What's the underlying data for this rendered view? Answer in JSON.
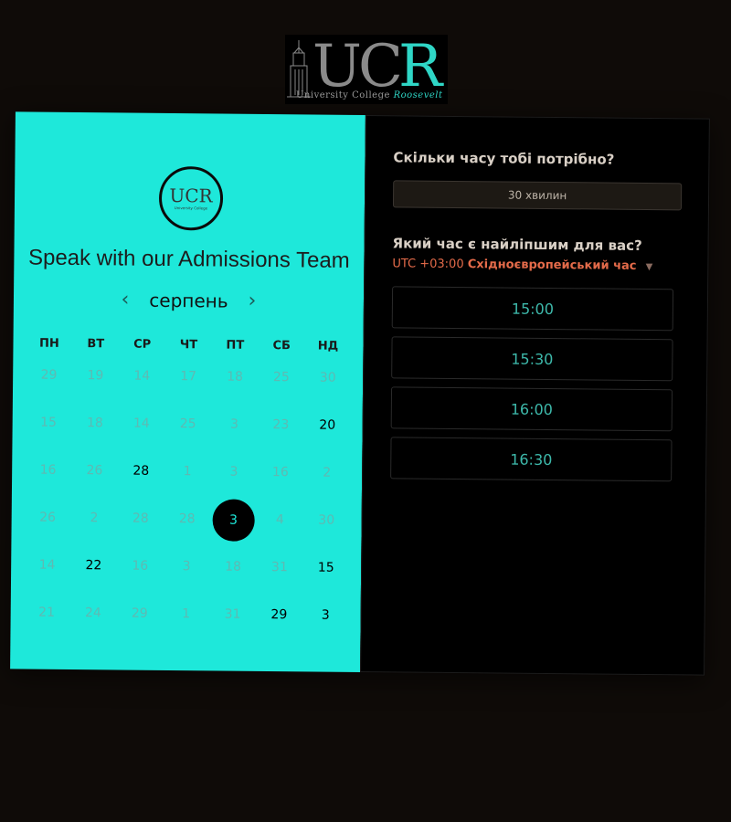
{
  "logo": {
    "letters_uc": "UC",
    "letter_r": "R",
    "subtitle_prefix": "University College",
    "subtitle_accent": "Roosevelt",
    "accent_color": "#2fd6c6"
  },
  "calendar": {
    "badge_text": "UCR",
    "title": "Speak with our Admissions Team",
    "month": "серпень",
    "prev_icon": "‹",
    "next_icon": "›",
    "weekdays": [
      "ПН",
      "ВТ",
      "СР",
      "ЧТ",
      "ПТ",
      "СБ",
      "НД"
    ],
    "weeks": [
      [
        {
          "d": "29"
        },
        {
          "d": "19"
        },
        {
          "d": "14"
        },
        {
          "d": "17"
        },
        {
          "d": "18"
        },
        {
          "d": "25"
        },
        {
          "d": "30"
        }
      ],
      [
        {
          "d": "15"
        },
        {
          "d": "18"
        },
        {
          "d": "14"
        },
        {
          "d": "25"
        },
        {
          "d": "3"
        },
        {
          "d": "23"
        },
        {
          "d": "20",
          "active": true
        }
      ],
      [
        {
          "d": "16"
        },
        {
          "d": "26"
        },
        {
          "d": "28",
          "active": true
        },
        {
          "d": "1"
        },
        {
          "d": "3"
        },
        {
          "d": "16"
        },
        {
          "d": "2"
        }
      ],
      [
        {
          "d": "26"
        },
        {
          "d": "2"
        },
        {
          "d": "28"
        },
        {
          "d": "28"
        },
        {
          "d": "3",
          "selected": true
        },
        {
          "d": "4"
        },
        {
          "d": "30"
        }
      ],
      [
        {
          "d": "14"
        },
        {
          "d": "22",
          "active": true
        },
        {
          "d": "16"
        },
        {
          "d": "3"
        },
        {
          "d": "18"
        },
        {
          "d": "31"
        },
        {
          "d": "15",
          "active": true
        }
      ],
      [
        {
          "d": "21"
        },
        {
          "d": "24"
        },
        {
          "d": "29"
        },
        {
          "d": "1"
        },
        {
          "d": "31"
        },
        {
          "d": "29",
          "active": true
        },
        {
          "d": "3",
          "active": true
        }
      ]
    ],
    "background_color": "#1ee8da"
  },
  "booking": {
    "duration_question": "Скільки часу тобі потрібно?",
    "duration_value": "30 хвилин",
    "time_question": "Який час є найліпшим для вас?",
    "timezone_offset": "UTC +03:00",
    "timezone_name": "Східноєвропейський час",
    "timezone_caret_icon": "caret-down-icon",
    "slots": [
      "15:00",
      "15:30",
      "16:00",
      "16:30"
    ],
    "slot_text_color": "#3db8aa",
    "timezone_color": "#e56b4a"
  }
}
